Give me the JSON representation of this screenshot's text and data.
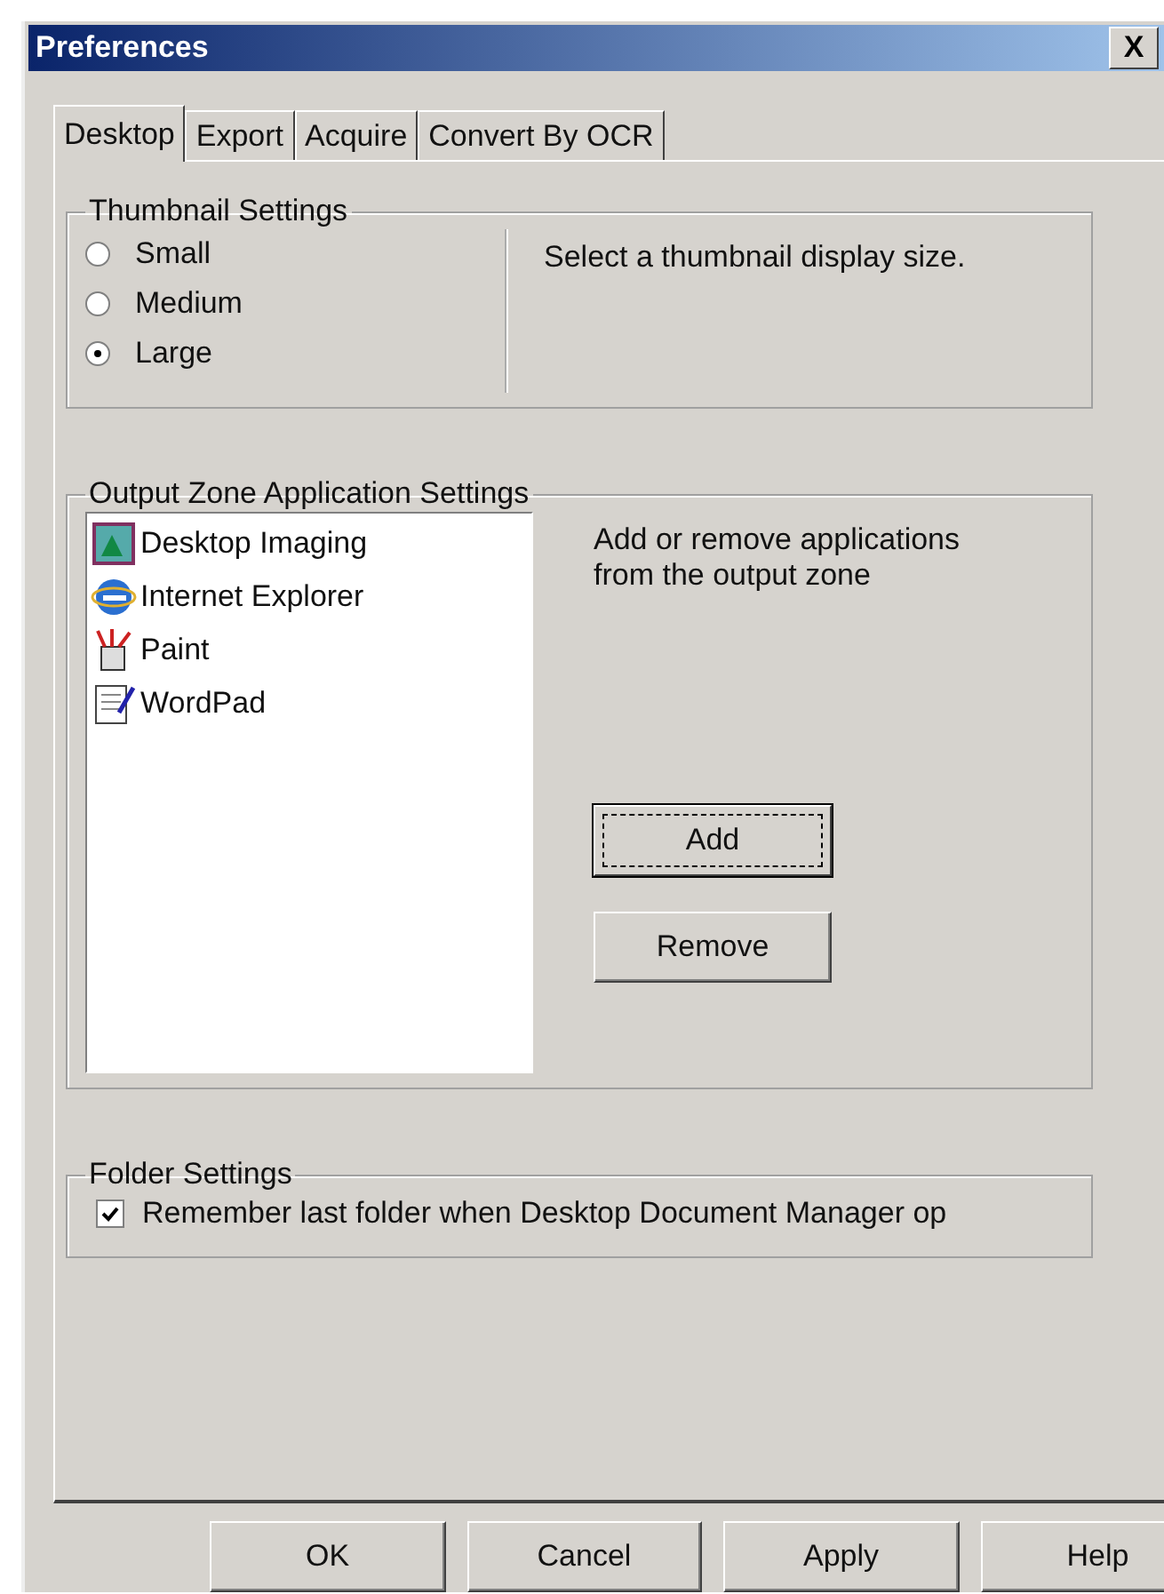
{
  "window": {
    "title": "Preferences",
    "close": "X"
  },
  "tabs": [
    {
      "label": "Desktop",
      "selected": true
    },
    {
      "label": "Export",
      "selected": false
    },
    {
      "label": "Acquire",
      "selected": false
    },
    {
      "label": "Convert By OCR",
      "selected": false
    }
  ],
  "thumbnail_settings": {
    "title": "Thumbnail Settings",
    "options": [
      {
        "label": "Small",
        "selected": false
      },
      {
        "label": "Medium",
        "selected": false
      },
      {
        "label": "Large",
        "selected": true
      }
    ],
    "hint": "Select a thumbnail display size."
  },
  "output_zone": {
    "title": "Output Zone Application Settings",
    "applications": [
      {
        "name": "Desktop Imaging",
        "kind": "imaging"
      },
      {
        "name": "Internet Explorer",
        "kind": "browser"
      },
      {
        "name": "Paint",
        "kind": "paint"
      },
      {
        "name": "WordPad",
        "kind": "wordpad"
      }
    ],
    "hint": "Add or remove applications from the output zone",
    "buttons": [
      {
        "label": "Add",
        "focused": true
      },
      {
        "label": "Remove",
        "focused": false
      }
    ]
  },
  "folder_settings": {
    "title": "Folder Settings",
    "checkbox": {
      "label": "Remember last folder when Desktop Document Manager op",
      "checked": true
    }
  },
  "buttons": [
    "OK",
    "Cancel",
    "Apply",
    "Help"
  ]
}
